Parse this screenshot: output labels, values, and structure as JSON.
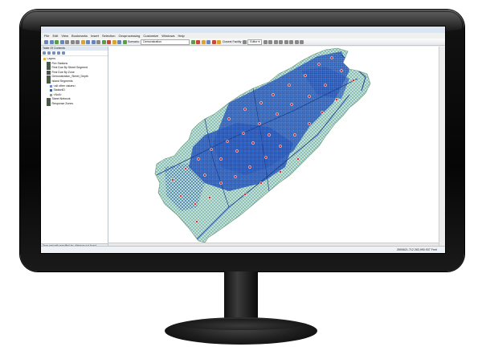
{
  "app": {
    "title": "",
    "menus": [
      "File",
      "Edit",
      "View",
      "Bookmarks",
      "Insert",
      "Selection",
      "Geoprocessing",
      "Customize",
      "Windows",
      "Help"
    ],
    "scenario_label": "Scenario:",
    "scenario_value": "Demonstration",
    "tool_label": "Closest Facility",
    "editor_label": "Editor ▾"
  },
  "toc": {
    "title": "Table Of Contents",
    "items": [
      {
        "label": "Layers",
        "indent": 0
      },
      {
        "label": "Fire Stations",
        "indent": 1
      },
      {
        "label": "First Due By Street Segment",
        "indent": 1
      },
      {
        "label": "First Due By Zone",
        "indent": 1
      },
      {
        "label": "Demonstration_Street_Depth",
        "indent": 1
      },
      {
        "label": "Island Segments",
        "indent": 1
      },
      {
        "label": "<all other values>",
        "indent": 2
      },
      {
        "label": "StationID",
        "indent": 2
      },
      {
        "label": "<Null>",
        "indent": 2
      },
      {
        "label": "Street Network",
        "indent": 1
      },
      {
        "label": "Response Zones",
        "indent": 1
      }
    ],
    "panel_title": "Drop net path specified by: distance not found"
  },
  "status": {
    "coords": "2690621.712  283,990.937 Feet"
  },
  "colors": {
    "map_fill": "#c6ebc8",
    "street_blue": "#2d5fbf",
    "station_red": "#d2332a"
  }
}
